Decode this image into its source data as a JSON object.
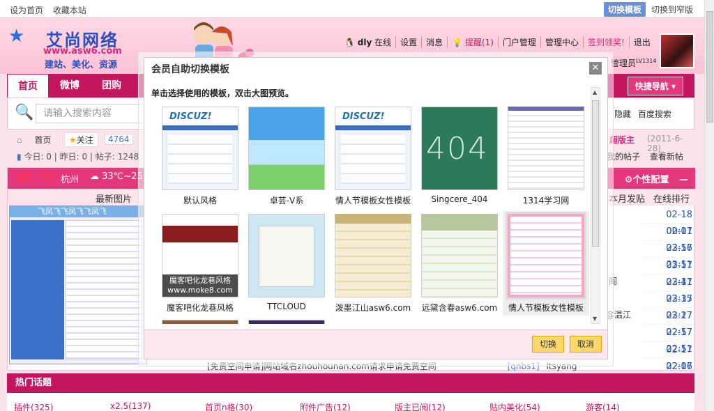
{
  "topbar": {
    "set_home": "设为首页",
    "bookmark": "收藏本站",
    "switch_template": "切换模板",
    "switch_narrow": "切换到窄版"
  },
  "logo": {
    "title": "艾尚网络",
    "url": "www.asw6.com",
    "slogan": "建站、美化、资源"
  },
  "user": {
    "name": "dly",
    "online": "在线",
    "settings": "设置",
    "messages": "消息",
    "remind": "提醒(1)",
    "portal_admin": "门户管理",
    "admin_center": "管理中心",
    "sign_in": "签到领奖!",
    "logout": "退出",
    "role": "管理员",
    "level": "LV1314"
  },
  "nav": {
    "tabs": [
      "首页",
      "微博",
      "团购"
    ],
    "quick_nav": "快捷导航"
  },
  "search": {
    "placeholder": "请输入搜索内容",
    "hide": "隐藏",
    "baidu": "百度搜索"
  },
  "crumb": {
    "home": "首页",
    "follow": "关注",
    "follow_count": "4764",
    "stats": "今日: 0 | 昨日: 0 | 帖子: 1248",
    "moderator": "超版主",
    "mod_date": "(2011-6-28)",
    "my_posts": "我的帖子",
    "new_posts": "查看新帖"
  },
  "info": {
    "clock": "02:33",
    "city": "杭州",
    "weather": "33℃~25℃",
    "personal": "个性配置",
    "latest_images": "最新图片",
    "month_posts": "本月发贴",
    "online_rank": "在线排行",
    "marquee": "飞凤飞飞凤飞飞凤飞"
  },
  "list": {
    "times": [
      "02-18 00:01",
      "02-17 23:56",
      "02-17 23:51",
      "02-17 23:41",
      "02-17 23:35",
      "02-17 23:27",
      "02-17 22:57",
      "02-17 22:51",
      "02-17 22:06",
      "02-17 21:57"
    ],
    "frag1": "阁",
    "frag2": "轮@温江",
    "last_row": "[免费空间申请]网站域名zhouhounan.com请求申请免费空间",
    "last_tag": "[qnbs1]",
    "last_user": "itsyang"
  },
  "hot": {
    "title": "热门话题",
    "items": [
      "插件(325)",
      "x2.5(137)",
      "首页n格(30)",
      "附件广告(12)",
      "版主已阅(12)",
      "贴内美化(54)",
      "游客(14)"
    ]
  },
  "modal": {
    "title": "会员自助切换模板",
    "hint": "单击选择使用的模板，双击大图预览。",
    "templates": [
      "默认风格",
      "卓芸-V系",
      "情人节模板女性模板",
      "Singcere_404",
      "1314学习网",
      "魔客吧化龙巷风格",
      "TTCLOUD",
      "泼墨江山asw6.com",
      "远黛含春asw6.com",
      "情人节模板女性模板"
    ],
    "thumb_brand": "DISCUZ!",
    "thumb_404": "404",
    "mk_caption1": "魔客吧化龙巷风格",
    "mk_caption2": "www.moke8.com",
    "ok": "切换",
    "cancel": "取消"
  }
}
